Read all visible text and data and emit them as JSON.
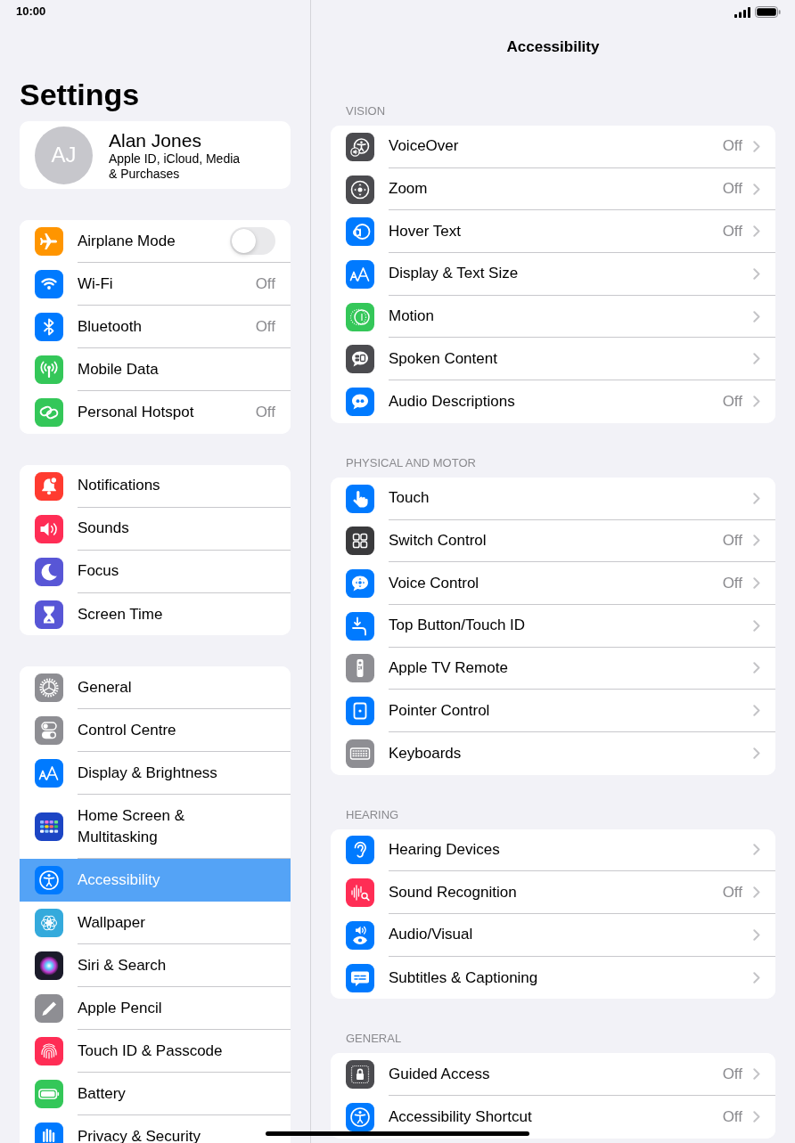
{
  "status_bar": {
    "time": "10:00"
  },
  "sidebar": {
    "title": "Settings",
    "profile": {
      "initials": "AJ",
      "name": "Alan Jones",
      "subtitle": "Apple ID, iCloud, Media & Purchases"
    },
    "groups": [
      {
        "items": [
          {
            "label": "Airplane Mode",
            "kind": "toggle",
            "on": false,
            "selected": false
          },
          {
            "label": "Wi-Fi",
            "kind": "link",
            "value": "Off",
            "selected": false
          },
          {
            "label": "Bluetooth",
            "kind": "link",
            "value": "Off",
            "selected": false
          },
          {
            "label": "Mobile Data",
            "kind": "link",
            "selected": false
          },
          {
            "label": "Personal Hotspot",
            "kind": "link",
            "value": "Off",
            "selected": false
          }
        ]
      },
      {
        "items": [
          {
            "label": "Notifications",
            "kind": "link",
            "selected": false
          },
          {
            "label": "Sounds",
            "kind": "link",
            "selected": false
          },
          {
            "label": "Focus",
            "kind": "link",
            "selected": false
          },
          {
            "label": "Screen Time",
            "kind": "link",
            "selected": false
          }
        ]
      },
      {
        "items": [
          {
            "label": "General",
            "kind": "link",
            "selected": false
          },
          {
            "label": "Control Centre",
            "kind": "link",
            "selected": false
          },
          {
            "label": "Display & Brightness",
            "kind": "link",
            "selected": false
          },
          {
            "label": "Home Screen & Multitasking",
            "kind": "link",
            "selected": false
          },
          {
            "label": "Accessibility",
            "kind": "link",
            "selected": true
          },
          {
            "label": "Wallpaper",
            "kind": "link",
            "selected": false
          },
          {
            "label": "Siri & Search",
            "kind": "link",
            "selected": false
          },
          {
            "label": "Apple Pencil",
            "kind": "link",
            "selected": false
          },
          {
            "label": "Touch ID & Passcode",
            "kind": "link",
            "selected": false
          },
          {
            "label": "Battery",
            "kind": "link",
            "selected": false
          },
          {
            "label": "Privacy & Security",
            "kind": "link",
            "selected": false
          }
        ]
      }
    ]
  },
  "detail": {
    "title": "Accessibility",
    "sections": [
      {
        "header": "VISION",
        "rows": [
          {
            "label": "VoiceOver",
            "value": "Off"
          },
          {
            "label": "Zoom",
            "value": "Off"
          },
          {
            "label": "Hover Text",
            "value": "Off"
          },
          {
            "label": "Display & Text Size"
          },
          {
            "label": "Motion"
          },
          {
            "label": "Spoken Content"
          },
          {
            "label": "Audio Descriptions",
            "value": "Off"
          }
        ]
      },
      {
        "header": "PHYSICAL AND MOTOR",
        "rows": [
          {
            "label": "Touch"
          },
          {
            "label": "Switch Control",
            "value": "Off"
          },
          {
            "label": "Voice Control",
            "value": "Off"
          },
          {
            "label": "Top Button/Touch ID"
          },
          {
            "label": "Apple TV Remote"
          },
          {
            "label": "Pointer Control"
          },
          {
            "label": "Keyboards"
          }
        ]
      },
      {
        "header": "HEARING",
        "rows": [
          {
            "label": "Hearing Devices"
          },
          {
            "label": "Sound Recognition",
            "value": "Off"
          },
          {
            "label": "Audio/Visual"
          },
          {
            "label": "Subtitles & Captioning"
          }
        ]
      },
      {
        "header": "GENERAL",
        "rows": [
          {
            "label": "Guided Access",
            "value": "Off"
          },
          {
            "label": "Accessibility Shortcut",
            "value": "Off"
          }
        ]
      }
    ]
  }
}
